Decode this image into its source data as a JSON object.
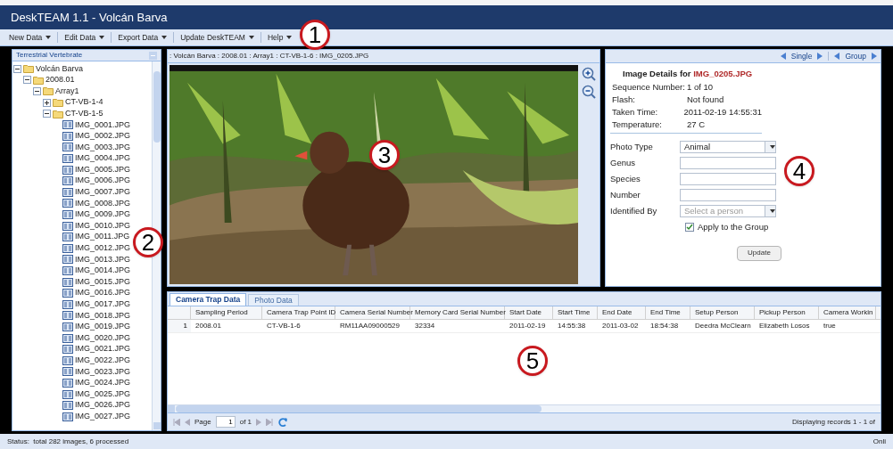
{
  "window": {
    "title": "DeskTEAM 1.1 - Volcán Barva"
  },
  "menu": [
    {
      "label": "New Data"
    },
    {
      "label": "Edit Data"
    },
    {
      "label": "Export Data"
    },
    {
      "label": "Update DeskTEAM"
    },
    {
      "label": "Help"
    }
  ],
  "tree": {
    "title": "Terrestrial Vertebrate",
    "items": [
      {
        "label": "Volcán Barva",
        "kind": "folder",
        "expanded": true,
        "children": [
          {
            "label": "2008.01",
            "kind": "folder",
            "expanded": true,
            "children": [
              {
                "label": "Array1",
                "kind": "folder",
                "expanded": true,
                "children": [
                  {
                    "label": "CT-VB-1-4",
                    "kind": "folder",
                    "expanded": false
                  },
                  {
                    "label": "CT-VB-1-5",
                    "kind": "folder",
                    "expanded": true,
                    "children": [
                      {
                        "label": "IMG_0001.JPG",
                        "kind": "file"
                      },
                      {
                        "label": "IMG_0002.JPG",
                        "kind": "file"
                      },
                      {
                        "label": "IMG_0003.JPG",
                        "kind": "file"
                      },
                      {
                        "label": "IMG_0004.JPG",
                        "kind": "file"
                      },
                      {
                        "label": "IMG_0005.JPG",
                        "kind": "file"
                      },
                      {
                        "label": "IMG_0006.JPG",
                        "kind": "file"
                      },
                      {
                        "label": "IMG_0007.JPG",
                        "kind": "file"
                      },
                      {
                        "label": "IMG_0008.JPG",
                        "kind": "file"
                      },
                      {
                        "label": "IMG_0009.JPG",
                        "kind": "file"
                      },
                      {
                        "label": "IMG_0010.JPG",
                        "kind": "file"
                      },
                      {
                        "label": "IMG_0011.JPG",
                        "kind": "file"
                      },
                      {
                        "label": "IMG_0012.JPG",
                        "kind": "file"
                      },
                      {
                        "label": "IMG_0013.JPG",
                        "kind": "file"
                      },
                      {
                        "label": "IMG_0014.JPG",
                        "kind": "file"
                      },
                      {
                        "label": "IMG_0015.JPG",
                        "kind": "file"
                      },
                      {
                        "label": "IMG_0016.JPG",
                        "kind": "file"
                      },
                      {
                        "label": "IMG_0017.JPG",
                        "kind": "file"
                      },
                      {
                        "label": "IMG_0018.JPG",
                        "kind": "file"
                      },
                      {
                        "label": "IMG_0019.JPG",
                        "kind": "file"
                      },
                      {
                        "label": "IMG_0020.JPG",
                        "kind": "file"
                      },
                      {
                        "label": "IMG_0021.JPG",
                        "kind": "file"
                      },
                      {
                        "label": "IMG_0022.JPG",
                        "kind": "file"
                      },
                      {
                        "label": "IMG_0023.JPG",
                        "kind": "file"
                      },
                      {
                        "label": "IMG_0024.JPG",
                        "kind": "file"
                      },
                      {
                        "label": "IMG_0025.JPG",
                        "kind": "file"
                      },
                      {
                        "label": "IMG_0026.JPG",
                        "kind": "file"
                      },
                      {
                        "label": "IMG_0027.JPG",
                        "kind": "file"
                      }
                    ]
                  }
                ]
              }
            ]
          }
        ]
      }
    ]
  },
  "viewer": {
    "breadcrumb": ": Volcán Barva : 2008.01 : Array1 : CT-VB-1-6 : IMG_0205.JPG"
  },
  "details": {
    "nav": [
      {
        "label": "Single"
      },
      {
        "label": "Group"
      }
    ],
    "heading_prefix": "Image Details for",
    "file_name": "IMG_0205.JPG",
    "info": [
      {
        "label": "Sequence Number:",
        "value": "1 of 10"
      },
      {
        "label": "Flash:",
        "value": "Not found"
      },
      {
        "label": "Taken Time:",
        "value": "2011-02-19 14:55:31"
      },
      {
        "label": "Temperature:",
        "value": "27 C"
      }
    ],
    "fields": [
      {
        "kind": "select",
        "label": "Photo Type",
        "value": "Animal"
      },
      {
        "kind": "text",
        "label": "Genus"
      },
      {
        "kind": "text",
        "label": "Species"
      },
      {
        "kind": "text",
        "label": "Number"
      },
      {
        "kind": "select",
        "label": "Identified By",
        "placeholder": "Select a person"
      },
      {
        "kind": "checkbox",
        "label": "Apply to the Group",
        "checked": true
      }
    ],
    "button": "Update"
  },
  "data_panel": {
    "tabs": [
      {
        "label": "Camera Trap Data",
        "selected": true
      },
      {
        "label": "Photo Data",
        "selected": false
      }
    ],
    "columns": [
      "Sampling Period",
      "Camera Trap Point ID",
      "Camera Serial Number",
      "Memory Card Serial Number",
      "Start Date",
      "Start Time",
      "End Date",
      "End Time",
      "Setup Person",
      "Pickup Person",
      "Camera Workin"
    ],
    "rows": [
      {
        "number": "1",
        "cells": [
          "2008.01",
          "CT-VB-1-6",
          "RM11AA09000529",
          "32334",
          "2011-02-19",
          "14:55:38",
          "2011-03-02",
          "18:54:38",
          "Deedra McClearn",
          "Elizabeth Losos",
          "true"
        ]
      }
    ],
    "pager": {
      "page_label": "Page",
      "page": "1",
      "of": "of 1",
      "summary": "Displaying records 1 - 1 of"
    }
  },
  "status_bar": {
    "text": "Status:  total 282 images, 6 processed",
    "right": "Onli"
  },
  "callouts": [
    "1",
    "2",
    "3",
    "4",
    "5"
  ]
}
